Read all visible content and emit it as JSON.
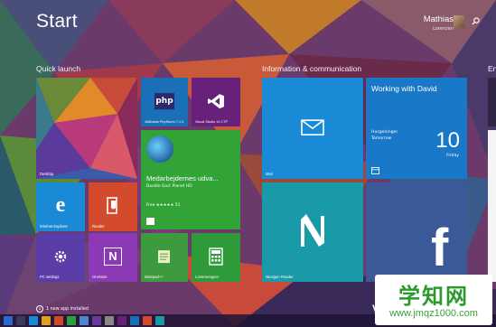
{
  "header": {
    "title": "Start",
    "user_name": "Mathias",
    "user_sub": "Lorenzen"
  },
  "groups": {
    "quick_launch": "Quick launch",
    "info": "Information & communication",
    "partial": "En"
  },
  "tiles": {
    "desktop": "Desktop",
    "phpstorm": "JetBrains PhpStorm 7.1.3",
    "phpstorm_icon_text": "php",
    "vs": "Visual Studio 14 CTP",
    "ie": "Internet Explorer",
    "reader": "Reader",
    "news_title": "Medarbejdernes udva...",
    "news_sub": "Doodle God: Planet HD",
    "news_rating": "Free ★★★★★ 51",
    "pcsettings": "PC settings",
    "onenote": "OneNote",
    "notepad": "Notepad++",
    "calculator": "Lommeregner",
    "mail": "Mail",
    "calendar_event": "Working with David",
    "calendar_loc": "Husgeninger",
    "calendar_when": "Tomorrow",
    "calendar_day_num": "10",
    "calendar_weekday": "Friday",
    "nextgen": "Nextgen Reader",
    "facebook_glyph": "f"
  },
  "install_note": "1 new app installed",
  "install_icon": "↓",
  "watermark": {
    "line1": "学知网",
    "line2": "www.jmqz1000.com"
  },
  "partial_letter": "V",
  "colors": {
    "mail": "#1b8ad6",
    "calendar": "#1a78c8",
    "store_green": "#31a337",
    "onenote": "#8b39b5",
    "pcsettings": "#5b3da8",
    "reader": "#d34a2c",
    "ie": "#1b8ad6",
    "php": "#1a6fb7",
    "vs": "#68217a",
    "nextgen": "#1a9aa8",
    "facebook": "#3b5998",
    "notepad": "#3e9a3e",
    "calc": "#2f9a3a"
  }
}
